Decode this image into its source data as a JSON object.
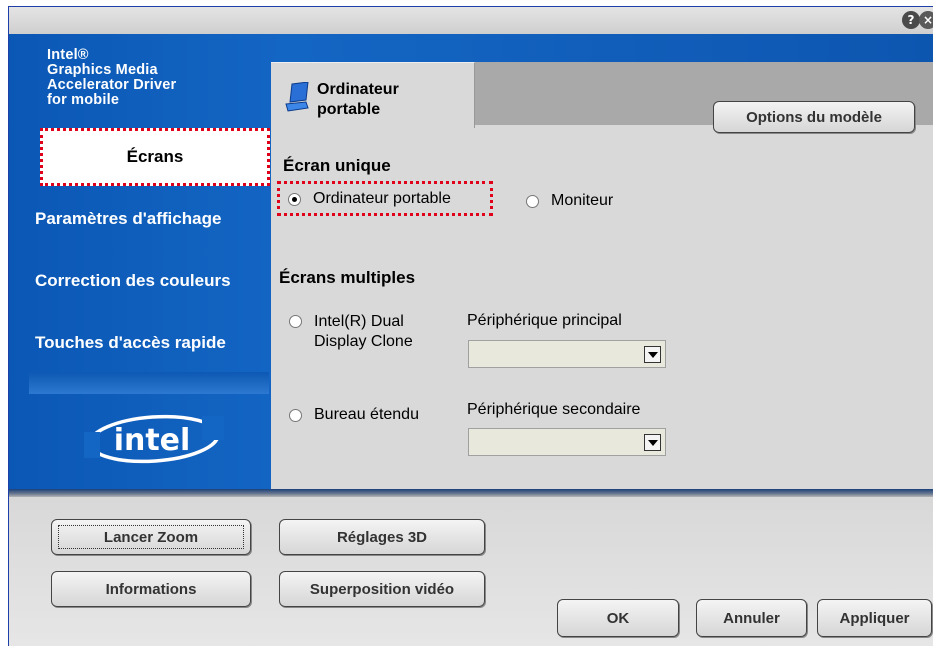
{
  "title_bar": {
    "help_icon": "question-icon",
    "help_label": "?",
    "close_icon": "close-icon",
    "close_label": "×"
  },
  "product_title": "Intel®\nGraphics Media\nAccelerator Driver\nfor mobile",
  "sidebar": {
    "items": [
      {
        "label": "Écrans",
        "selected": true
      },
      {
        "label": "Paramètres d'affichage"
      },
      {
        "label": "Correction des couleurs"
      },
      {
        "label": "Touches d'accès rapide"
      }
    ],
    "logo": "intel"
  },
  "tabs": [
    {
      "label": "Ordinateur\nportable",
      "icon": "laptop-icon",
      "selected": true
    }
  ],
  "template_options_label": "Options du modèle",
  "single_screen": {
    "heading": "Écran unique",
    "options": [
      {
        "label": "Ordinateur portable",
        "checked": true
      },
      {
        "label": "Moniteur",
        "checked": false
      }
    ]
  },
  "multiple_screens": {
    "heading": "Écrans multiples",
    "options": [
      {
        "label": "Intel(R) Dual\nDisplay Clone",
        "checked": false
      },
      {
        "label": "Bureau étendu",
        "checked": false
      }
    ],
    "primary_device_label": "Périphérique principal",
    "primary_device_value": "",
    "secondary_device_label": "Périphérique secondaire",
    "secondary_device_value": ""
  },
  "bottom_buttons": {
    "zoom": "Lancer Zoom",
    "settings_3d": "Réglages 3D",
    "info": "Informations",
    "video_overlay": "Superposition vidéo",
    "ok": "OK",
    "cancel": "Annuler",
    "apply": "Appliquer"
  },
  "colors": {
    "panel_blue": "#1466c4",
    "highlight_red": "#e0001a"
  }
}
